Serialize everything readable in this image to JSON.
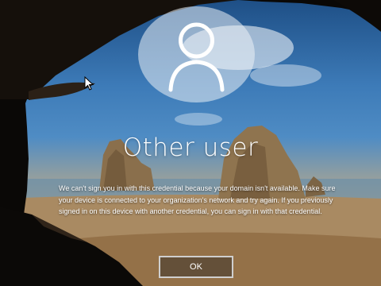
{
  "login": {
    "user_name": "Other user",
    "error_message": "We can't sign you in with this credential because your domain isn't available. Make sure your device is connected to your organization's network and try again. If you previously signed in on this device with another credential, you can sign in with that credential.",
    "ok_button_label": "OK"
  },
  "icons": {
    "avatar": "user-silhouette-icon",
    "pointer": "mouse-pointer-icon"
  },
  "colors": {
    "text": "#ffffff",
    "button_border": "#cfcfcf",
    "avatar_fill": "#ebf0f6"
  }
}
